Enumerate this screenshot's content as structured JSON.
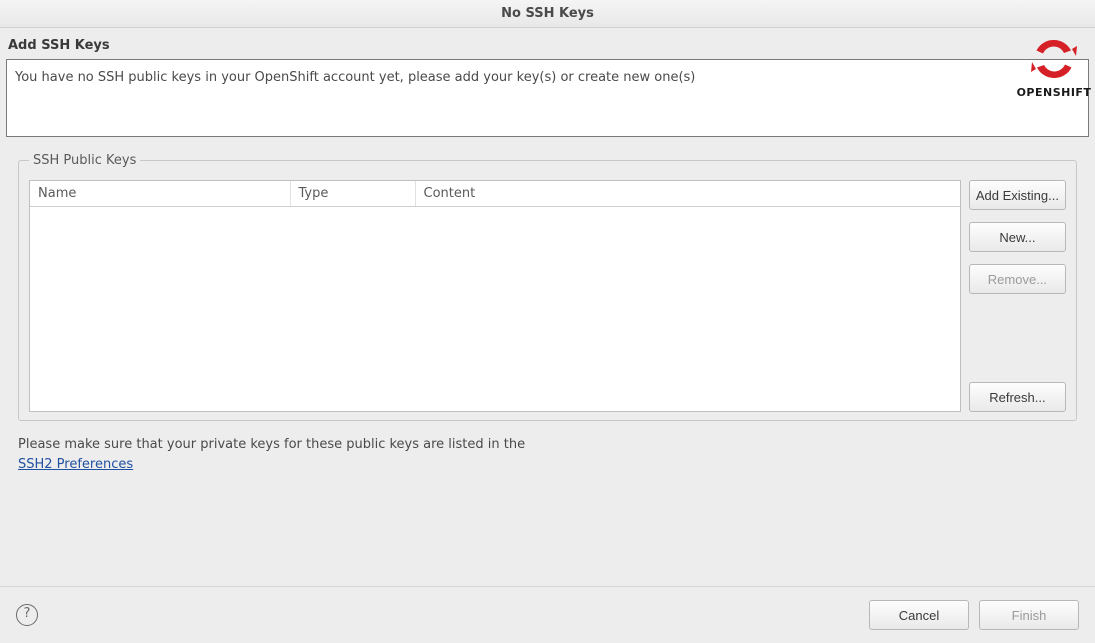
{
  "window": {
    "title": "No SSH Keys"
  },
  "header": {
    "title": "Add SSH Keys",
    "description": "You have no SSH public keys in your OpenShift account yet, please add your key(s) or create new one(s)",
    "brand_label": "OPENSHIFT",
    "brand_color": "#d62027"
  },
  "group": {
    "legend": "SSH Public Keys",
    "columns": {
      "name": "Name",
      "type": "Type",
      "content": "Content"
    },
    "rows": []
  },
  "side_buttons": {
    "add_existing": "Add Existing...",
    "new": "New...",
    "remove": "Remove...",
    "refresh": "Refresh...",
    "remove_enabled": false
  },
  "hint": {
    "text": "Please make sure that your private keys for these public keys are listed in the ",
    "link_label": "SSH2 Preferences"
  },
  "footer": {
    "help_symbol": "?",
    "cancel": "Cancel",
    "finish": "Finish",
    "finish_enabled": false
  }
}
